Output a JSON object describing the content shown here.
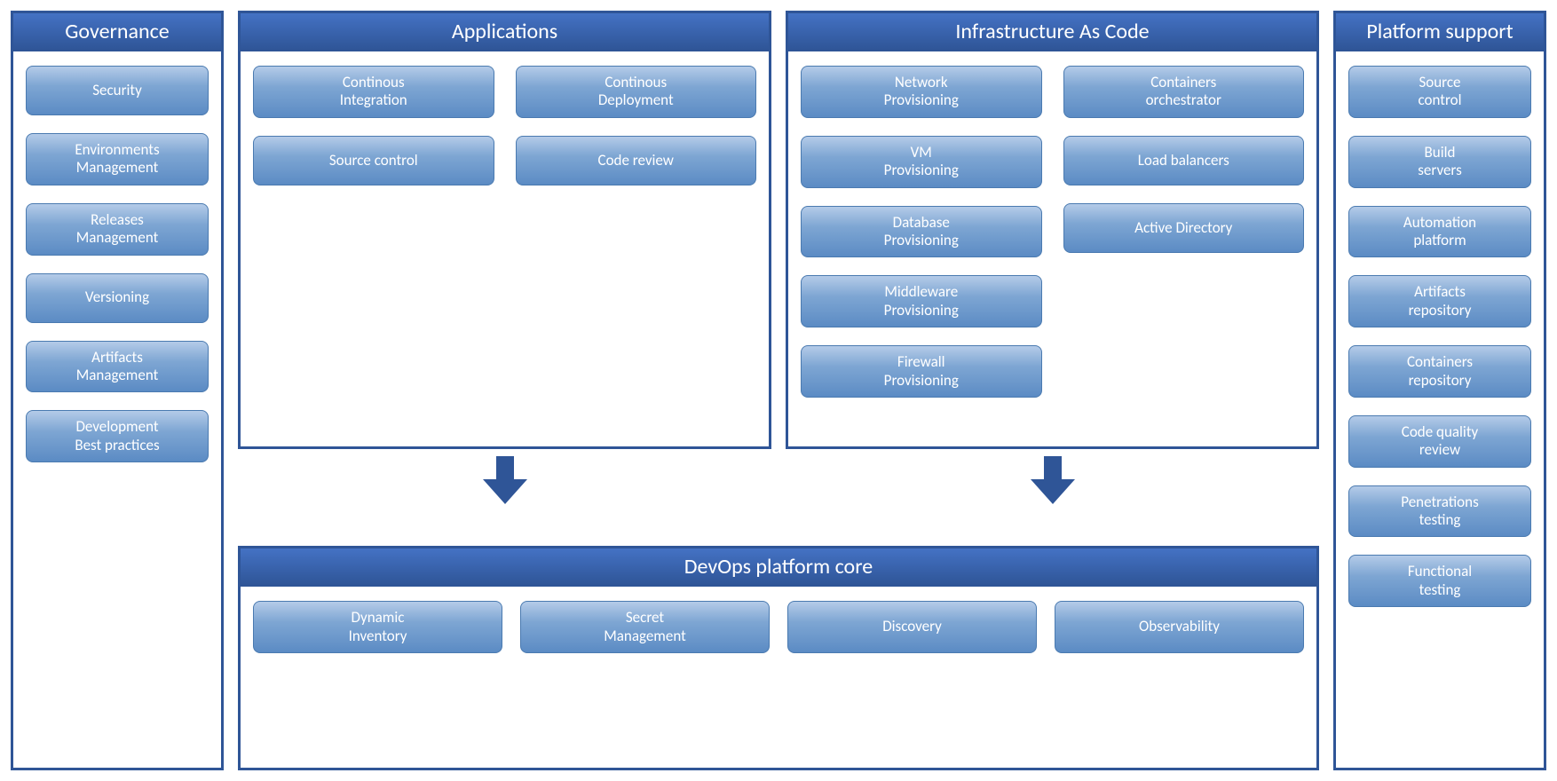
{
  "governance": {
    "title": "Governance",
    "items": [
      "Security",
      "Environments\nManagement",
      "Releases\nManagement",
      "Versioning",
      "Artifacts\nManagement",
      "Development\nBest practices"
    ]
  },
  "applications": {
    "title": "Applications",
    "items": [
      "Continous\nIntegration",
      "Continous\nDeployment",
      "Source control",
      "Code review"
    ]
  },
  "iac": {
    "title": "Infrastructure As Code",
    "left": [
      "Network\nProvisioning",
      "VM\nProvisioning",
      "Database\nProvisioning",
      "Middleware\nProvisioning",
      "Firewall\nProvisioning"
    ],
    "right": [
      "Containers\norchestrator",
      "Load balancers",
      "Active Directory"
    ]
  },
  "core": {
    "title": "DevOps platform core",
    "items": [
      "Dynamic\nInventory",
      "Secret\nManagement",
      "Discovery",
      "Observability"
    ]
  },
  "support": {
    "title": "Platform support",
    "items": [
      "Source\ncontrol",
      "Build\nservers",
      "Automation\nplatform",
      "Artifacts\nrepository",
      "Containers\nrepository",
      "Code quality\nreview",
      "Penetrations\ntesting",
      "Functional\ntesting"
    ]
  }
}
